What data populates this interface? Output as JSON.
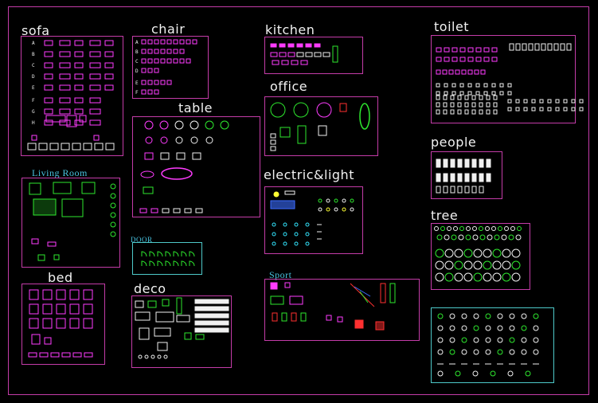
{
  "groups": {
    "sofa": {
      "title": "sofa",
      "rows": [
        "A",
        "B",
        "C",
        "D",
        "E",
        "F",
        "G",
        "H"
      ]
    },
    "chair": {
      "title": "chair",
      "rows": [
        "A",
        "B",
        "C",
        "D",
        "E",
        "F"
      ]
    },
    "table": {
      "title": "table"
    },
    "living": {
      "title": "Living Room"
    },
    "door": {
      "title": "DOOR"
    },
    "bed": {
      "title": "bed"
    },
    "deco": {
      "title": "deco"
    },
    "kitchen": {
      "title": "kitchen"
    },
    "office": {
      "title": "office"
    },
    "electric": {
      "title": "electric&light"
    },
    "sport": {
      "title": "Sport"
    },
    "toilet": {
      "title": "toilet"
    },
    "people": {
      "title": "people"
    },
    "tree": {
      "title": "tree"
    },
    "misc": {
      "title": ""
    }
  },
  "colors": {
    "background": "#000000",
    "frame": "#c43ca8",
    "frame_alt": "#4ec9c9",
    "title": "#f2f2f2",
    "serif_title": "#49c2e0",
    "magenta": "#ff3cff",
    "green": "#2ee82e",
    "white": "#f0f0f0",
    "yellow": "#ffff33",
    "red": "#ff3030",
    "cyan": "#33e6ff",
    "blue": "#3b6cff"
  }
}
